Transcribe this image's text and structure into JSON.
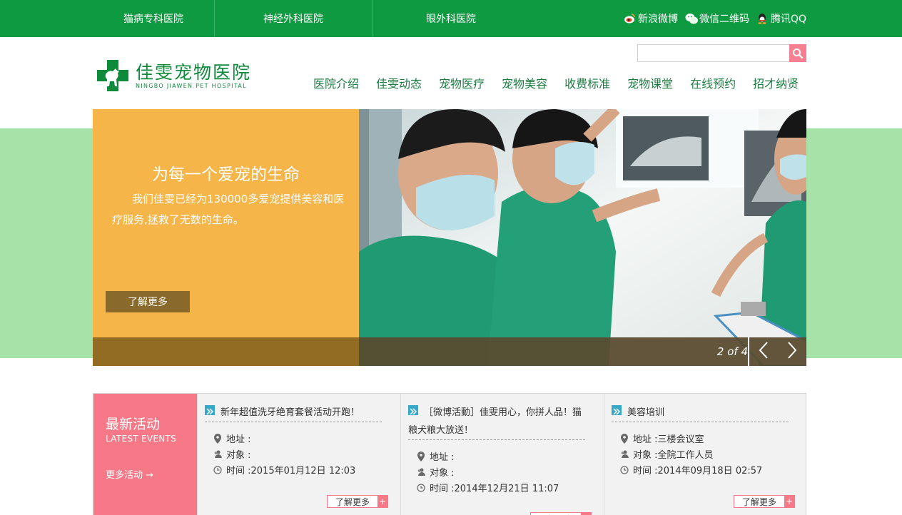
{
  "topbar": {
    "hospitals": [
      "猫病专科医院",
      "神经外科医院",
      "眼外科医院"
    ],
    "social": [
      {
        "icon": "weibo-icon",
        "label": "新浪微博"
      },
      {
        "icon": "wechat-icon",
        "label": "微信二维码"
      },
      {
        "icon": "qq-icon",
        "label": "腾讯QQ"
      }
    ]
  },
  "header": {
    "logo_cn": "佳雯宠物医院",
    "logo_en": "NINGBO JIAWEN PET HOSPITAL",
    "search_placeholder": "",
    "nav": [
      "医院介绍",
      "佳雯动态",
      "宠物医疗",
      "宠物美容",
      "收费标准",
      "宠物课堂",
      "在线预约",
      "招才纳贤"
    ]
  },
  "banner": {
    "title": "为每一个爱宠的生命",
    "description": "我们佳雯已经为130000多爱宠提供美容和医疗服务,拯救了无数的生命。",
    "button": "了解更多",
    "counter": "2 of 4"
  },
  "events": {
    "title": "最新活动",
    "subtitle": "LATEST EVENTS",
    "more": "更多活动 →",
    "address_label": "地址 :",
    "audience_label": "对象 :",
    "time_label": "时间 :",
    "more_button": "了解更多",
    "items": [
      {
        "title": "新年超值洗牙绝育套餐活动开跑！",
        "address": "",
        "audience": "",
        "time": "2015年01月12日 12:03"
      },
      {
        "title": "［微博活動］佳雯用心，你拼人品！猫粮犬粮大放送！",
        "address": "",
        "audience": "",
        "time": "2014年12月21日 11:07"
      },
      {
        "title": "美容培训",
        "address": "三楼会议室",
        "audience": "全院工作人员",
        "time": "2014年09月18日 02:57"
      }
    ]
  },
  "colors": {
    "green": "#0d9a40",
    "pink": "#f77988",
    "orange": "#f5b549",
    "band": "#a7e2a9"
  }
}
